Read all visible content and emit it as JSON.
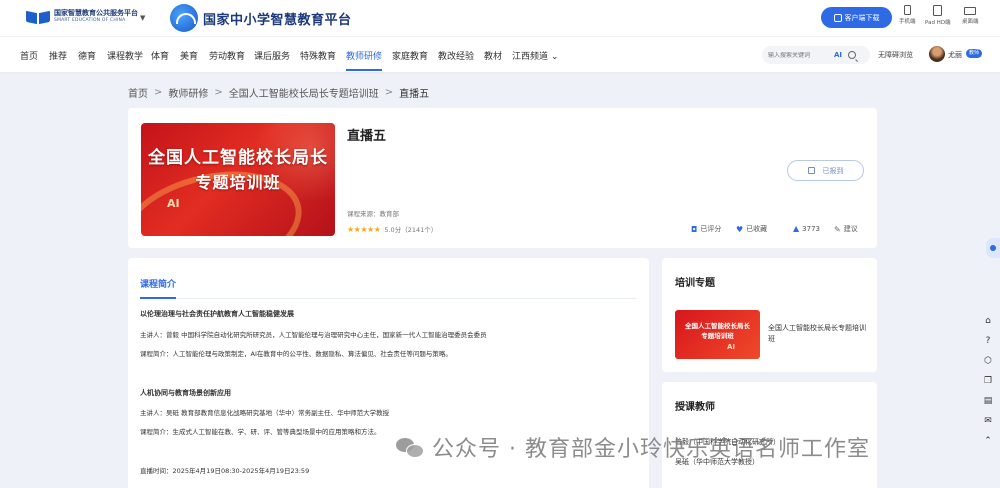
{
  "header": {
    "smart_logo_cn": "国家智慧教育公共服务平台",
    "smart_logo_en": "SMART EDUCATION OF CHINA",
    "platform_caret": "▼",
    "platform_title": "国家中小学智慧教育平台",
    "download_label": "客户端下载",
    "devices": [
      "手机端",
      "Pad HD端",
      "桌面端"
    ]
  },
  "nav": {
    "items": [
      "首页",
      "推荐",
      "德育",
      "课程教学",
      "体育",
      "美育",
      "劳动教育",
      "课后服务",
      "特殊教育",
      "教师研修",
      "家庭教育",
      "教改经验",
      "教材",
      "江西频道 ⌄"
    ],
    "active_index": 9,
    "search_placeholder": "输入搜索关键词",
    "ai_label": "AI",
    "barrier_free": "无障碍浏览",
    "user_name": "尤丽",
    "user_badge": "教师"
  },
  "breadcrumb": {
    "items": [
      "首页",
      "教师研修",
      "全国人工智能校长局长专题培训班",
      "直播五"
    ],
    "separator": ">"
  },
  "course": {
    "banner_line1": "全国人工智能校长局长",
    "banner_line2": "专题培训班",
    "banner_ai": "AI",
    "title": "直播五",
    "signup_label": "已报到",
    "source": "课程来源：教育部",
    "stars": "★★★★★",
    "rating_text": "5.0分（2141个）",
    "actions": {
      "rated": "已评分",
      "favorited": "已收藏",
      "likes": "3773",
      "suggest": "建议"
    }
  },
  "intro": {
    "tab_label": "课程简介",
    "lines": [
      "以伦理治理与社会责任护航教育人工智能稳健发展",
      "主讲人：曾毅  中国科学院自动化研究所研究员，人工智能伦理与治理研究中心主任，国家新一代人工智能治理委员会委员",
      "课程简介：人工智能伦理与政策制定，AI在教育中的公平性、数据隐私、算法偏见、社会责任等问题与策略。",
      "人机协同与教育场景创新应用",
      "主讲人：吴砥  教育部教育信息化战略研究基地（华中）常务副主任、华中师范大学教授",
      "课程简介：生成式人工智能在教、学、研、评、管等典型场景中的应用策略和方法。",
      "直播时间：2025年4月19日08:30-2025年4月19日23:59"
    ]
  },
  "training": {
    "title": "培训专题",
    "mini_line1": "全国人工智能校长局长",
    "mini_line2": "专题培训班",
    "mini_ai": "AI",
    "course_name": "全国人工智能校长局长专题培训班"
  },
  "teachers": {
    "title": "授课教师",
    "list": [
      "曾毅（中国科学院自动化研究所）",
      "吴砥（华中师范大学教授）"
    ]
  },
  "watermark": "公众号 · 教育部金小玲快乐英语名师工作室",
  "colors": {
    "accent": "#2e6ae6",
    "banner_red": "#c4131a",
    "star": "#ffa51f"
  }
}
